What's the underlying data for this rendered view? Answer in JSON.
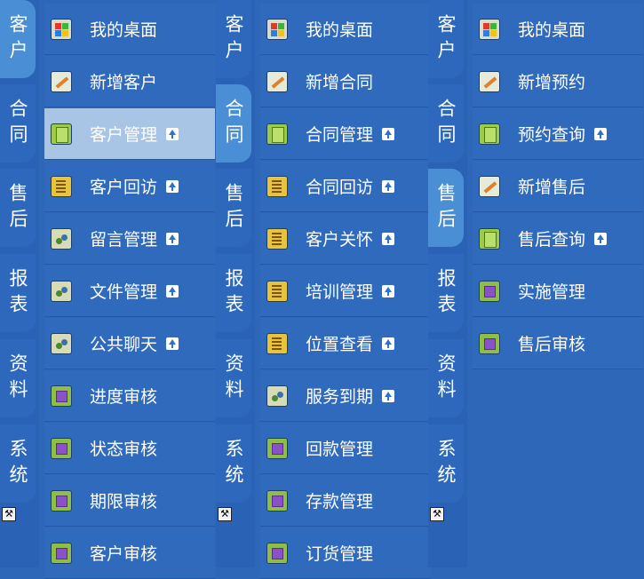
{
  "panels": [
    {
      "tabs": [
        {
          "label": "客户",
          "active": true
        },
        {
          "label": "合同",
          "active": false
        },
        {
          "label": "售后",
          "active": false
        },
        {
          "label": "报表",
          "active": false
        },
        {
          "label": "资料",
          "active": false
        },
        {
          "label": "系统",
          "active": false
        }
      ],
      "items": [
        {
          "label": "我的桌面",
          "icon": "windows-icon",
          "arrow": false,
          "active": false
        },
        {
          "label": "新增客户",
          "icon": "edit-icon",
          "arrow": false,
          "active": false
        },
        {
          "label": "客户管理",
          "icon": "document-icon",
          "arrow": true,
          "active": true
        },
        {
          "label": "客户回访",
          "icon": "note-icon",
          "arrow": true,
          "active": false
        },
        {
          "label": "留言管理",
          "icon": "share-icon",
          "arrow": true,
          "active": false
        },
        {
          "label": "文件管理",
          "icon": "share-icon",
          "arrow": true,
          "active": false
        },
        {
          "label": "公共聊天",
          "icon": "share-icon",
          "arrow": true,
          "active": false
        },
        {
          "label": "进度审核",
          "icon": "audit-icon",
          "arrow": false,
          "active": false
        },
        {
          "label": "状态审核",
          "icon": "audit-icon",
          "arrow": false,
          "active": false
        },
        {
          "label": "期限审核",
          "icon": "audit-icon",
          "arrow": false,
          "active": false
        },
        {
          "label": "客户审核",
          "icon": "audit-icon",
          "arrow": false,
          "active": false
        }
      ]
    },
    {
      "tabs": [
        {
          "label": "客户",
          "active": false
        },
        {
          "label": "合同",
          "active": true
        },
        {
          "label": "售后",
          "active": false
        },
        {
          "label": "报表",
          "active": false
        },
        {
          "label": "资料",
          "active": false
        },
        {
          "label": "系统",
          "active": false
        }
      ],
      "items": [
        {
          "label": "我的桌面",
          "icon": "windows-icon",
          "arrow": false,
          "active": false
        },
        {
          "label": "新增合同",
          "icon": "edit-icon",
          "arrow": false,
          "active": false
        },
        {
          "label": "合同管理",
          "icon": "document-icon",
          "arrow": true,
          "active": false
        },
        {
          "label": "合同回访",
          "icon": "note-icon",
          "arrow": true,
          "active": false
        },
        {
          "label": "客户关怀",
          "icon": "note-icon",
          "arrow": true,
          "active": false
        },
        {
          "label": "培训管理",
          "icon": "note-icon",
          "arrow": true,
          "active": false
        },
        {
          "label": "位置查看",
          "icon": "note-icon",
          "arrow": true,
          "active": false
        },
        {
          "label": "服务到期",
          "icon": "share-icon",
          "arrow": true,
          "active": false
        },
        {
          "label": "回款管理",
          "icon": "audit-icon",
          "arrow": false,
          "active": false
        },
        {
          "label": "存款管理",
          "icon": "audit-icon",
          "arrow": false,
          "active": false
        },
        {
          "label": "订货管理",
          "icon": "audit-icon",
          "arrow": false,
          "active": false
        }
      ]
    },
    {
      "tabs": [
        {
          "label": "客户",
          "active": false
        },
        {
          "label": "合同",
          "active": false
        },
        {
          "label": "售后",
          "active": true
        },
        {
          "label": "报表",
          "active": false
        },
        {
          "label": "资料",
          "active": false
        },
        {
          "label": "系统",
          "active": false
        }
      ],
      "items": [
        {
          "label": "我的桌面",
          "icon": "windows-icon",
          "arrow": false,
          "active": false
        },
        {
          "label": "新增预约",
          "icon": "edit-icon",
          "arrow": false,
          "active": false
        },
        {
          "label": "预约查询",
          "icon": "document-icon",
          "arrow": true,
          "active": false
        },
        {
          "label": "新增售后",
          "icon": "edit-icon",
          "arrow": false,
          "active": false
        },
        {
          "label": "售后查询",
          "icon": "document-icon",
          "arrow": true,
          "active": false
        },
        {
          "label": "实施管理",
          "icon": "audit-icon",
          "arrow": false,
          "active": false
        },
        {
          "label": "售后审核",
          "icon": "audit-icon",
          "arrow": false,
          "active": false
        }
      ]
    }
  ],
  "toolbox_icon": "toolbox-icon"
}
